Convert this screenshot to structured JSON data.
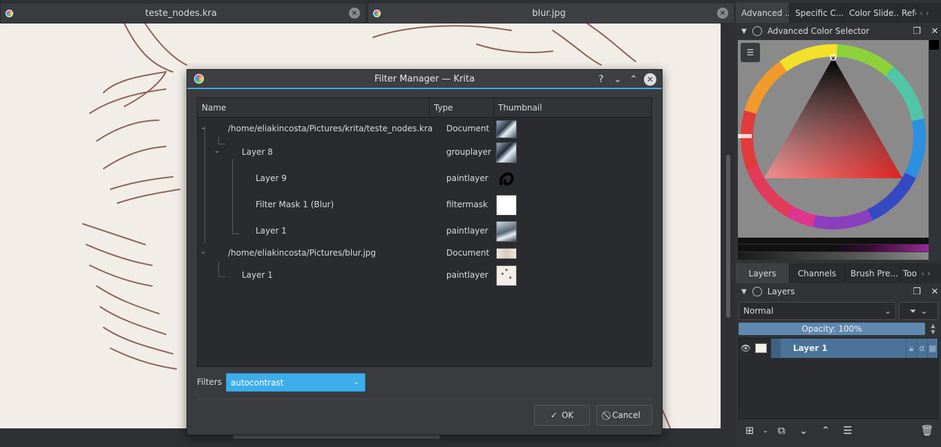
{
  "doc_tabs": [
    {
      "label": "teste_nodes.kra"
    },
    {
      "label": "blur.jpg"
    }
  ],
  "docker_top_tabs": [
    "Advanced ...",
    "Specific C...",
    "Color Slide...",
    "Refe"
  ],
  "color_selector": {
    "title": "Advanced Color Selector"
  },
  "docker_mid_tabs": [
    "Layers",
    "Channels",
    "Brush Pre...",
    "Too"
  ],
  "layers_docker": {
    "title": "Layers",
    "blend_mode": "Normal",
    "opacity_label": "Opacity:  100%",
    "layer_name": "Layer 1",
    "alpha_symbol": "α"
  },
  "dialog": {
    "title": "Filter Manager — Krita",
    "columns": [
      "Name",
      "Type",
      "Thumbnail"
    ],
    "rows": [
      {
        "name": "/home/eliakincosta/Pictures/krita/teste_nodes.kra",
        "type": "Document"
      },
      {
        "name": "Layer 8",
        "type": "grouplayer"
      },
      {
        "name": "Layer 9",
        "type": "paintlayer"
      },
      {
        "name": "Filter Mask 1 (Blur)",
        "type": "filtermask"
      },
      {
        "name": "Layer 1",
        "type": "paintlayer"
      },
      {
        "name": "/home/eliakincosta/Pictures/blur.jpg",
        "type": "Document"
      },
      {
        "name": "Layer 1",
        "type": "paintlayer"
      }
    ],
    "filters_label": "Filters",
    "filter_value": "autocontrast",
    "ok_label": "OK",
    "cancel_label": "Cancel"
  },
  "colors": {
    "accent": "#3daee9",
    "selected_layer": "#4b739a",
    "sketch_stroke": "#7a4a3c"
  },
  "icons": [
    "close-icon",
    "help-icon",
    "minimize-icon",
    "maximize-icon",
    "chevron-down-icon",
    "filter-icon",
    "eye-icon",
    "lock-icon",
    "check-icon",
    "cancel-icon",
    "add-layer-icon",
    "duplicate-icon",
    "move-down-icon",
    "move-up-icon",
    "properties-icon",
    "trash-icon"
  ]
}
